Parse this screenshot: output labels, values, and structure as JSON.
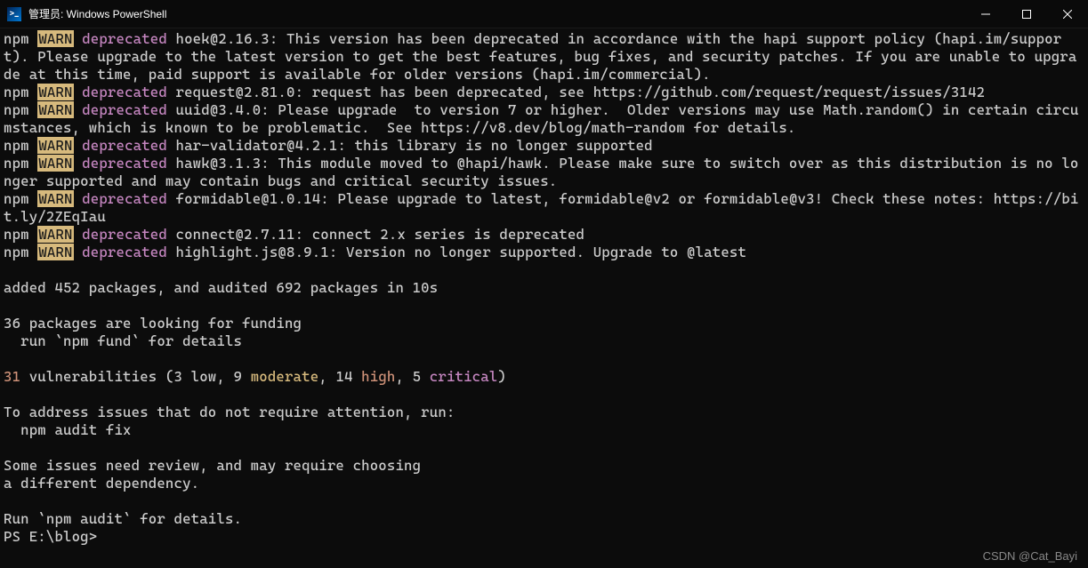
{
  "titlebar": {
    "title": "管理员: Windows PowerShell",
    "icon_label": ">_"
  },
  "terminal": {
    "warns": [
      {
        "ver": "hoek@2.16.3:",
        "msg": " This version has been deprecated in accordance with the hapi support policy (hapi.im/support). Please upgrade to the latest version to get the best features, bug fixes, and security patches. If you are unable to upgrade at this time, paid support is available for older versions (hapi.im/commercial)."
      },
      {
        "ver": "request@2.81.0:",
        "msg": " request has been deprecated, see https://github.com/request/request/issues/3142"
      },
      {
        "ver": "uuid@3.4.0:",
        "msg": " Please upgrade  to version 7 or higher.  Older versions may use Math.random() in certain circumstances, which is known to be problematic.  See https://v8.dev/blog/math-random for details."
      },
      {
        "ver": "har-validator@4.2.1:",
        "msg": " this library is no longer supported"
      },
      {
        "ver": "hawk@3.1.3:",
        "msg": " This module moved to @hapi/hawk. Please make sure to switch over as this distribution is no longer supported and may contain bugs and critical security issues."
      },
      {
        "ver": "formidable@1.0.14:",
        "msg": " Please upgrade to latest, formidable@v2 or formidable@v3! Check these notes: https://bit.ly/2ZEqIau"
      },
      {
        "ver": "connect@2.7.11:",
        "msg": " connect 2.x series is deprecated"
      },
      {
        "ver": "highlight.js@8.9.1:",
        "msg": " Version no longer supported. Upgrade to @latest"
      }
    ],
    "npm_label": "npm ",
    "warn_label": "WARN",
    "deprecated_label": " deprecated ",
    "blank": "",
    "added_line": "added 452 packages, and audited 692 packages in 10s",
    "funding1": "36 packages are looking for funding",
    "funding2": "  run `npm fund` for details",
    "vuln_count": "31",
    "vuln_open": " vulnerabilities (3 low, 9 ",
    "vuln_moderate": "moderate",
    "vuln_mid1": ", 14 ",
    "vuln_high": "high",
    "vuln_mid2": ", 5 ",
    "vuln_critical": "critical",
    "vuln_close": ")",
    "address1": "To address issues that do not require attention, run:",
    "address2": "  npm audit fix",
    "review1": "Some issues need review, and may require choosing",
    "review2": "a different dependency.",
    "run_audit": "Run `npm audit` for details.",
    "prompt": "PS E:\\blog>"
  },
  "watermark": "CSDN @Cat_Bayi"
}
